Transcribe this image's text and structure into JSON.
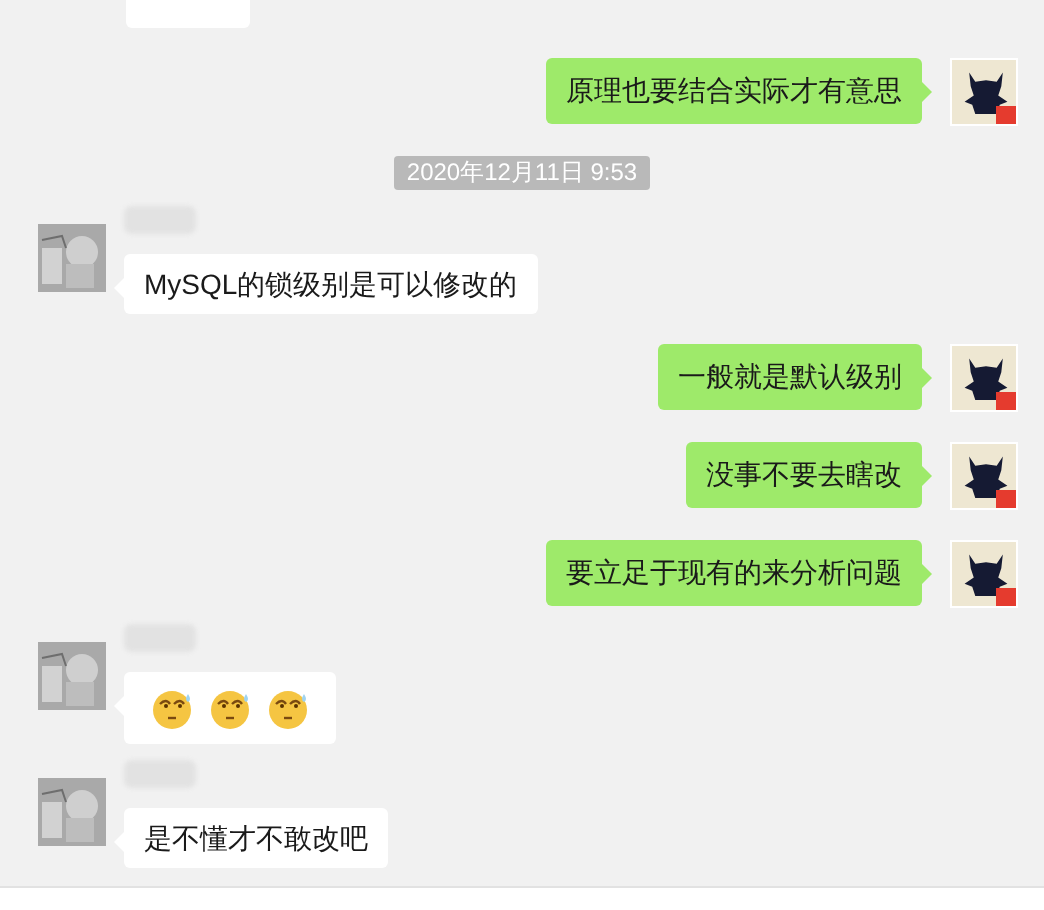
{
  "messages": [
    {
      "kind": "incoming_cut"
    },
    {
      "kind": "outgoing",
      "text": "原理也要结合实际才有意思"
    },
    {
      "kind": "time",
      "text": "2020年12月11日 9:53"
    },
    {
      "kind": "incoming",
      "text": "MySQL的锁级别是可以修改的"
    },
    {
      "kind": "outgoing",
      "text": "一般就是默认级别"
    },
    {
      "kind": "outgoing",
      "text": "没事不要去瞎改"
    },
    {
      "kind": "outgoing",
      "text": "要立足于现有的来分析问题"
    },
    {
      "kind": "incoming",
      "emojis": [
        {
          "kind": "sweat-face"
        },
        {
          "kind": "sweat-face"
        },
        {
          "kind": "sweat-face"
        }
      ]
    },
    {
      "kind": "incoming",
      "text": "是不懂才不敢改吧"
    }
  ]
}
